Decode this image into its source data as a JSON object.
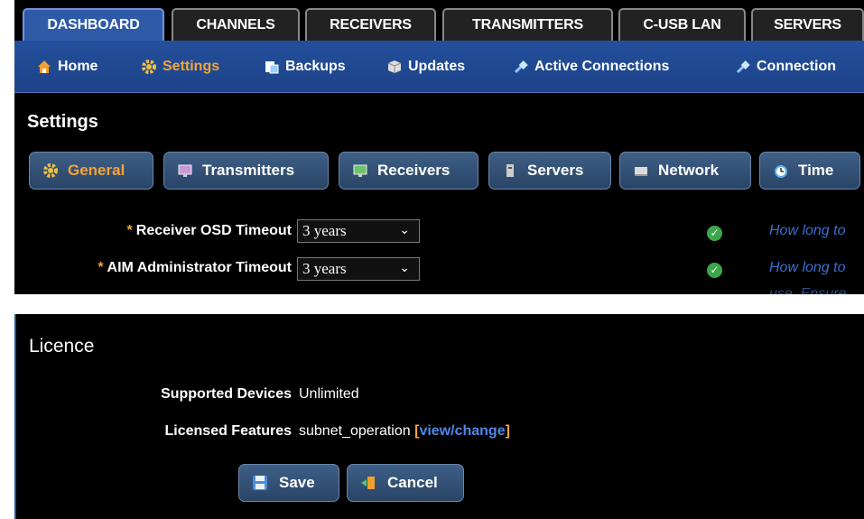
{
  "tabs": [
    "DASHBOARD",
    "CHANNELS",
    "RECEIVERS",
    "TRANSMITTERS",
    "C-USB LAN",
    "SERVERS"
  ],
  "subnav": {
    "home": "Home",
    "settings": "Settings",
    "backups": "Backups",
    "updates": "Updates",
    "active_connections": "Active Connections",
    "connection": "Connection"
  },
  "settings": {
    "title": "Settings",
    "buttons": {
      "general": "General",
      "transmitters": "Transmitters",
      "receivers": "Receivers",
      "servers": "Servers",
      "network": "Network",
      "time": "Time"
    },
    "rows": [
      {
        "required": "*",
        "label": "Receiver OSD Timeout",
        "value": "3 years",
        "help": "How long to"
      },
      {
        "required": "*",
        "label": "AIM Administrator Timeout",
        "value": "3 years",
        "help": "How long to",
        "help2": "use. Ensure"
      }
    ]
  },
  "licence": {
    "title": "Licence",
    "supported_label": "Supported Devices",
    "supported_value": "Unlimited",
    "features_label": "Licensed Features",
    "features_value": "subnet_operation",
    "bracket_open": "[",
    "link": "view/change",
    "bracket_close": "]"
  },
  "actions": {
    "save": "Save",
    "cancel": "Cancel"
  },
  "colors": {
    "accent": "#f5a33c",
    "nav_blue": "#2e5aa8",
    "ok_green": "#3aa84a",
    "help_blue": "#3b6fd0"
  }
}
